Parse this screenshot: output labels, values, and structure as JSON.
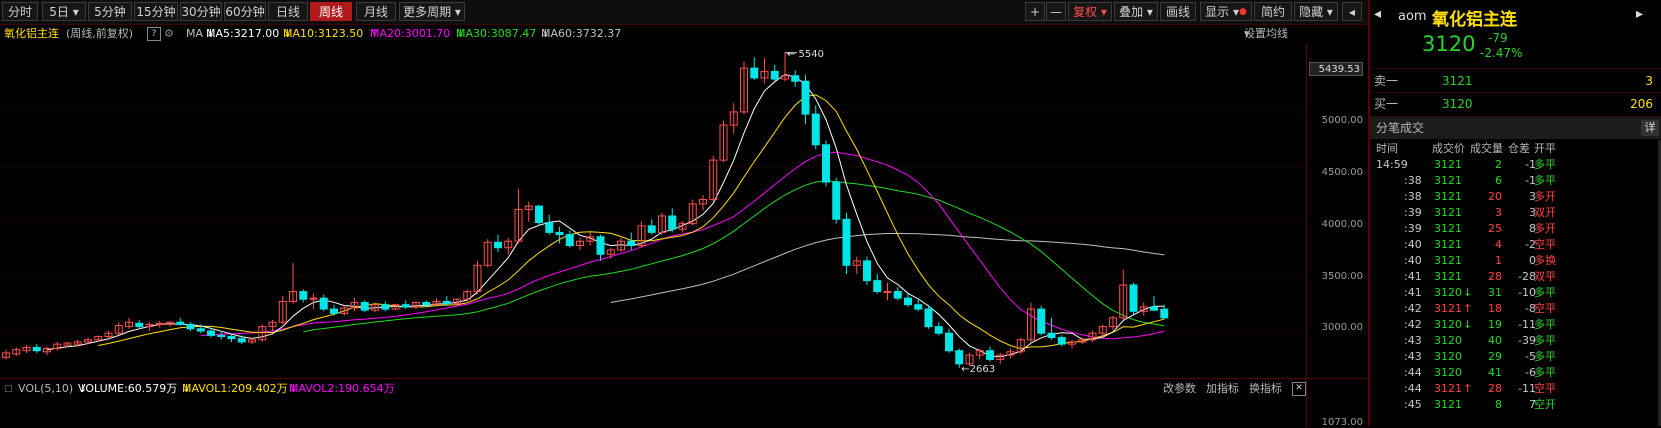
{
  "toolbar": {
    "periods": [
      "分时",
      "5日",
      "5分钟",
      "15分钟",
      "30分钟",
      "60分钟",
      "日线",
      "周线",
      "月线",
      "更多周期"
    ],
    "active_period": "周线",
    "right_buttons": [
      "+",
      "—",
      "复权",
      "叠加",
      "画线",
      "显示",
      "简约",
      "隐藏"
    ]
  },
  "info": {
    "name": "氧化铝主连",
    "mode": "(周线,前复权)",
    "help": "?",
    "ma_label": "MA",
    "ma5": "MA5:3217.00",
    "ma10": "MA10:3123.50",
    "ma20": "MA20:3001.70",
    "ma30": "MA30:3087.47",
    "ma60": "MA60:3732.37",
    "settings": "设置均线"
  },
  "colors": {
    "up": "#ff4d4d",
    "down": "#00e5e5",
    "ma5": "#ffffff",
    "ma10": "#ffe000",
    "ma20": "#ff00ff",
    "ma30": "#22dd22",
    "ma60": "#c0c0c0",
    "accent": "#b11a1a"
  },
  "axis": {
    "current_price": "5439.53",
    "ticks": [
      "5000.00",
      "4500.00",
      "4000.00",
      "3500.00",
      "3000.00"
    ],
    "bottom_tick": "1073.00"
  },
  "annotations": {
    "high": "5540",
    "low": "2663"
  },
  "volume": {
    "label": "VOL(5,10)",
    "volume": "VOLUME:60.579万",
    "mavol1": "MAVOL1:209.402万",
    "mavol2": "MAVOL2:190.654万",
    "buttons": [
      "改参数",
      "加指标",
      "换指标",
      "✕"
    ]
  },
  "chart_data": {
    "type": "candlestick",
    "series": [
      {
        "o": 2760,
        "h": 2830,
        "l": 2740,
        "c": 2800
      },
      {
        "o": 2790,
        "h": 2850,
        "l": 2770,
        "c": 2830
      },
      {
        "o": 2820,
        "h": 2870,
        "l": 2800,
        "c": 2850
      },
      {
        "o": 2850,
        "h": 2880,
        "l": 2800,
        "c": 2820
      },
      {
        "o": 2810,
        "h": 2860,
        "l": 2780,
        "c": 2840
      },
      {
        "o": 2840,
        "h": 2900,
        "l": 2820,
        "c": 2880
      },
      {
        "o": 2870,
        "h": 2900,
        "l": 2850,
        "c": 2890
      },
      {
        "o": 2880,
        "h": 2920,
        "l": 2860,
        "c": 2900
      },
      {
        "o": 2900,
        "h": 2940,
        "l": 2880,
        "c": 2920
      },
      {
        "o": 2920,
        "h": 2960,
        "l": 2900,
        "c": 2950
      },
      {
        "o": 2950,
        "h": 3000,
        "l": 2920,
        "c": 2980
      },
      {
        "o": 2980,
        "h": 3080,
        "l": 2960,
        "c": 3050
      },
      {
        "o": 3040,
        "h": 3120,
        "l": 3020,
        "c": 3080
      },
      {
        "o": 3070,
        "h": 3100,
        "l": 3020,
        "c": 3040
      },
      {
        "o": 3040,
        "h": 3080,
        "l": 3000,
        "c": 3060
      },
      {
        "o": 3060,
        "h": 3090,
        "l": 3030,
        "c": 3070
      },
      {
        "o": 3060,
        "h": 3090,
        "l": 3040,
        "c": 3080
      },
      {
        "o": 3080,
        "h": 3120,
        "l": 3050,
        "c": 3060
      },
      {
        "o": 3060,
        "h": 3080,
        "l": 3000,
        "c": 3020
      },
      {
        "o": 3020,
        "h": 3060,
        "l": 2980,
        "c": 3000
      },
      {
        "o": 3000,
        "h": 3030,
        "l": 2940,
        "c": 2960
      },
      {
        "o": 2960,
        "h": 3000,
        "l": 2920,
        "c": 2950
      },
      {
        "o": 2950,
        "h": 2980,
        "l": 2900,
        "c": 2930
      },
      {
        "o": 2930,
        "h": 2960,
        "l": 2880,
        "c": 2900
      },
      {
        "o": 2900,
        "h": 2940,
        "l": 2880,
        "c": 2920
      },
      {
        "o": 2920,
        "h": 3060,
        "l": 2900,
        "c": 3040
      },
      {
        "o": 3040,
        "h": 3100,
        "l": 3000,
        "c": 3080
      },
      {
        "o": 3080,
        "h": 3320,
        "l": 3060,
        "c": 3270
      },
      {
        "o": 3270,
        "h": 3620,
        "l": 3250,
        "c": 3360
      },
      {
        "o": 3360,
        "h": 3380,
        "l": 3260,
        "c": 3290
      },
      {
        "o": 3290,
        "h": 3340,
        "l": 3200,
        "c": 3300
      },
      {
        "o": 3300,
        "h": 3330,
        "l": 3180,
        "c": 3200
      },
      {
        "o": 3200,
        "h": 3240,
        "l": 3140,
        "c": 3160
      },
      {
        "o": 3160,
        "h": 3230,
        "l": 3140,
        "c": 3210
      },
      {
        "o": 3210,
        "h": 3300,
        "l": 3180,
        "c": 3260
      },
      {
        "o": 3260,
        "h": 3280,
        "l": 3170,
        "c": 3190
      },
      {
        "o": 3190,
        "h": 3260,
        "l": 3170,
        "c": 3240
      },
      {
        "o": 3240,
        "h": 3270,
        "l": 3180,
        "c": 3200
      },
      {
        "o": 3200,
        "h": 3250,
        "l": 3190,
        "c": 3240
      },
      {
        "o": 3240,
        "h": 3280,
        "l": 3200,
        "c": 3220
      },
      {
        "o": 3220,
        "h": 3270,
        "l": 3200,
        "c": 3260
      },
      {
        "o": 3260,
        "h": 3280,
        "l": 3220,
        "c": 3240
      },
      {
        "o": 3240,
        "h": 3300,
        "l": 3220,
        "c": 3270
      },
      {
        "o": 3270,
        "h": 3320,
        "l": 3230,
        "c": 3250
      },
      {
        "o": 3250,
        "h": 3300,
        "l": 3230,
        "c": 3290
      },
      {
        "o": 3290,
        "h": 3380,
        "l": 3270,
        "c": 3360
      },
      {
        "o": 3360,
        "h": 3640,
        "l": 3340,
        "c": 3600
      },
      {
        "o": 3600,
        "h": 3840,
        "l": 3580,
        "c": 3810
      },
      {
        "o": 3810,
        "h": 3880,
        "l": 3720,
        "c": 3760
      },
      {
        "o": 3760,
        "h": 3850,
        "l": 3700,
        "c": 3820
      },
      {
        "o": 3820,
        "h": 4300,
        "l": 3800,
        "c": 4110
      },
      {
        "o": 4110,
        "h": 4180,
        "l": 4000,
        "c": 4140
      },
      {
        "o": 4140,
        "h": 4150,
        "l": 3960,
        "c": 3990
      },
      {
        "o": 3990,
        "h": 4060,
        "l": 3880,
        "c": 3900
      },
      {
        "o": 3900,
        "h": 3950,
        "l": 3800,
        "c": 3880
      },
      {
        "o": 3880,
        "h": 3920,
        "l": 3760,
        "c": 3780
      },
      {
        "o": 3780,
        "h": 3850,
        "l": 3740,
        "c": 3820
      },
      {
        "o": 3820,
        "h": 3900,
        "l": 3780,
        "c": 3860
      },
      {
        "o": 3860,
        "h": 3880,
        "l": 3640,
        "c": 3700
      },
      {
        "o": 3700,
        "h": 3760,
        "l": 3660,
        "c": 3740
      },
      {
        "o": 3740,
        "h": 3850,
        "l": 3720,
        "c": 3820
      },
      {
        "o": 3820,
        "h": 3900,
        "l": 3740,
        "c": 3780
      },
      {
        "o": 3780,
        "h": 4000,
        "l": 3760,
        "c": 3960
      },
      {
        "o": 3960,
        "h": 4020,
        "l": 3880,
        "c": 3900
      },
      {
        "o": 3900,
        "h": 4080,
        "l": 3880,
        "c": 4050
      },
      {
        "o": 4050,
        "h": 4120,
        "l": 3900,
        "c": 3930
      },
      {
        "o": 3930,
        "h": 4000,
        "l": 3900,
        "c": 3980
      },
      {
        "o": 3980,
        "h": 4200,
        "l": 3960,
        "c": 4160
      },
      {
        "o": 4160,
        "h": 4240,
        "l": 4100,
        "c": 4200
      },
      {
        "o": 4200,
        "h": 4600,
        "l": 4180,
        "c": 4560
      },
      {
        "o": 4560,
        "h": 4920,
        "l": 4540,
        "c": 4880
      },
      {
        "o": 4880,
        "h": 5080,
        "l": 4800,
        "c": 5000
      },
      {
        "o": 5000,
        "h": 5460,
        "l": 4980,
        "c": 5400
      },
      {
        "o": 5400,
        "h": 5500,
        "l": 5290,
        "c": 5310
      },
      {
        "o": 5310,
        "h": 5490,
        "l": 5260,
        "c": 5370
      },
      {
        "o": 5370,
        "h": 5430,
        "l": 5280,
        "c": 5300
      },
      {
        "o": 5300,
        "h": 5540,
        "l": 5280,
        "c": 5330
      },
      {
        "o": 5330,
        "h": 5380,
        "l": 5230,
        "c": 5280
      },
      {
        "o": 5280,
        "h": 5340,
        "l": 4890,
        "c": 4980
      },
      {
        "o": 4980,
        "h": 5060,
        "l": 4660,
        "c": 4700
      },
      {
        "o": 4700,
        "h": 4740,
        "l": 4320,
        "c": 4360
      },
      {
        "o": 4360,
        "h": 4400,
        "l": 3980,
        "c": 4020
      },
      {
        "o": 4020,
        "h": 4080,
        "l": 3520,
        "c": 3600
      },
      {
        "o": 3600,
        "h": 3680,
        "l": 3520,
        "c": 3640
      },
      {
        "o": 3640,
        "h": 3680,
        "l": 3420,
        "c": 3460
      },
      {
        "o": 3460,
        "h": 3520,
        "l": 3340,
        "c": 3360
      },
      {
        "o": 3360,
        "h": 3440,
        "l": 3280,
        "c": 3360
      },
      {
        "o": 3360,
        "h": 3400,
        "l": 3280,
        "c": 3300
      },
      {
        "o": 3300,
        "h": 3340,
        "l": 3220,
        "c": 3240
      },
      {
        "o": 3240,
        "h": 3300,
        "l": 3180,
        "c": 3200
      },
      {
        "o": 3200,
        "h": 3240,
        "l": 3020,
        "c": 3040
      },
      {
        "o": 3040,
        "h": 3080,
        "l": 2960,
        "c": 2980
      },
      {
        "o": 2980,
        "h": 3020,
        "l": 2800,
        "c": 2820
      },
      {
        "o": 2820,
        "h": 2840,
        "l": 2663,
        "c": 2700
      },
      {
        "o": 2700,
        "h": 2800,
        "l": 2680,
        "c": 2780
      },
      {
        "o": 2780,
        "h": 2840,
        "l": 2740,
        "c": 2820
      },
      {
        "o": 2820,
        "h": 2860,
        "l": 2720,
        "c": 2740
      },
      {
        "o": 2740,
        "h": 2800,
        "l": 2700,
        "c": 2780
      },
      {
        "o": 2780,
        "h": 2840,
        "l": 2750,
        "c": 2810
      },
      {
        "o": 2810,
        "h": 2940,
        "l": 2790,
        "c": 2920
      },
      {
        "o": 2920,
        "h": 3260,
        "l": 2900,
        "c": 3200
      },
      {
        "o": 3200,
        "h": 3230,
        "l": 2960,
        "c": 2980
      },
      {
        "o": 2980,
        "h": 3120,
        "l": 2920,
        "c": 2940
      },
      {
        "o": 2940,
        "h": 2960,
        "l": 2860,
        "c": 2880
      },
      {
        "o": 2880,
        "h": 2920,
        "l": 2840,
        "c": 2900
      },
      {
        "o": 2900,
        "h": 2940,
        "l": 2880,
        "c": 2920
      },
      {
        "o": 2920,
        "h": 3000,
        "l": 2900,
        "c": 2980
      },
      {
        "o": 2980,
        "h": 3060,
        "l": 2950,
        "c": 3040
      },
      {
        "o": 3040,
        "h": 3140,
        "l": 3010,
        "c": 3120
      },
      {
        "o": 3120,
        "h": 3560,
        "l": 3100,
        "c": 3420
      },
      {
        "o": 3420,
        "h": 3440,
        "l": 3150,
        "c": 3180
      },
      {
        "o": 3180,
        "h": 3260,
        "l": 3140,
        "c": 3220
      },
      {
        "o": 3220,
        "h": 3320,
        "l": 3180,
        "c": 3190
      },
      {
        "o": 3199,
        "h": 3240,
        "l": 3110,
        "c": 3120
      }
    ],
    "ylim": [
      2580,
      5620
    ]
  },
  "quote": {
    "code": "aom",
    "name": "氧化铝主连",
    "price": "3120",
    "change": "-79",
    "change_pct": "-2.47%",
    "sell_label": "卖一",
    "sell_price": "3121",
    "sell_vol": "3",
    "buy_label": "买一",
    "buy_price": "3120",
    "buy_vol": "206",
    "ticks_title": "分笔成交",
    "detail_btn": "详",
    "headers": [
      "时间",
      "成交价",
      "成交量",
      "仓差",
      "开平"
    ]
  },
  "ticks": [
    {
      "t": "14:59",
      "p": "3121",
      "a": "",
      "v": "2",
      "d": "-1",
      "k": "多平",
      "pc": "g",
      "vc": "g",
      "kc": "g"
    },
    {
      "t": ":38",
      "p": "3121",
      "a": "",
      "v": "6",
      "d": "-1",
      "k": "多平",
      "pc": "g",
      "vc": "g",
      "kc": "g"
    },
    {
      "t": ":38",
      "p": "3121",
      "a": "",
      "v": "20",
      "d": "3",
      "k": "多开",
      "pc": "g",
      "vc": "r",
      "kc": "r"
    },
    {
      "t": ":39",
      "p": "3121",
      "a": "",
      "v": "3",
      "d": "3",
      "k": "双开",
      "pc": "g",
      "vc": "r",
      "kc": "r"
    },
    {
      "t": ":39",
      "p": "3121",
      "a": "",
      "v": "25",
      "d": "8",
      "k": "多开",
      "pc": "g",
      "vc": "r",
      "kc": "r"
    },
    {
      "t": ":40",
      "p": "3121",
      "a": "",
      "v": "4",
      "d": "-2",
      "k": "空平",
      "pc": "g",
      "vc": "r",
      "kc": "r"
    },
    {
      "t": ":40",
      "p": "3121",
      "a": "",
      "v": "1",
      "d": "0",
      "k": "多换",
      "pc": "g",
      "vc": "r",
      "kc": "r"
    },
    {
      "t": ":41",
      "p": "3121",
      "a": "",
      "v": "28",
      "d": "-28",
      "k": "双平",
      "pc": "g",
      "vc": "r",
      "kc": "r"
    },
    {
      "t": ":41",
      "p": "3120",
      "a": "↓",
      "v": "31",
      "d": "-10",
      "k": "多平",
      "pc": "g",
      "vc": "g",
      "kc": "g"
    },
    {
      "t": ":42",
      "p": "3121",
      "a": "↑",
      "v": "18",
      "d": "-8",
      "k": "空平",
      "pc": "r",
      "vc": "r",
      "kc": "r"
    },
    {
      "t": ":42",
      "p": "3120",
      "a": "↓",
      "v": "19",
      "d": "-11",
      "k": "多平",
      "pc": "g",
      "vc": "g",
      "kc": "g"
    },
    {
      "t": ":43",
      "p": "3120",
      "a": "",
      "v": "40",
      "d": "-39",
      "k": "多平",
      "pc": "g",
      "vc": "g",
      "kc": "g"
    },
    {
      "t": ":43",
      "p": "3120",
      "a": "",
      "v": "29",
      "d": "-5",
      "k": "多平",
      "pc": "g",
      "vc": "g",
      "kc": "g"
    },
    {
      "t": ":44",
      "p": "3120",
      "a": "",
      "v": "41",
      "d": "-6",
      "k": "多平",
      "pc": "g",
      "vc": "g",
      "kc": "g"
    },
    {
      "t": ":44",
      "p": "3121",
      "a": "↑",
      "v": "28",
      "d": "-11",
      "k": "空平",
      "pc": "r",
      "vc": "r",
      "kc": "r"
    },
    {
      "t": ":45",
      "p": "3121",
      "a": "",
      "v": "8",
      "d": "7",
      "k": "空开",
      "pc": "g",
      "vc": "g",
      "kc": "g"
    }
  ]
}
